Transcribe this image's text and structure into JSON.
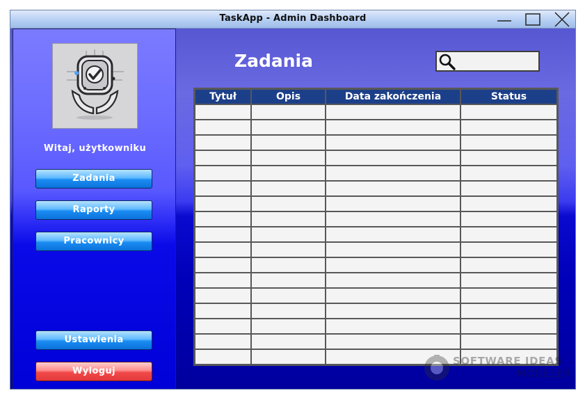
{
  "window": {
    "title": "TaskApp - Admin Dashboard"
  },
  "sidebar": {
    "welcome": "Witaj, użytkowniku",
    "nav": [
      {
        "label": "Zadania"
      },
      {
        "label": "Raporty"
      },
      {
        "label": "Pracownicy"
      }
    ],
    "settings_label": "Ustawienia",
    "logout_label": "Wyloguj"
  },
  "main": {
    "title": "Zadania",
    "search": {
      "value": "",
      "placeholder": ""
    },
    "table": {
      "columns": [
        "Tytuł",
        "Opis",
        "Data zakończenia",
        "Status"
      ],
      "rows": [
        [
          "",
          "",
          "",
          ""
        ],
        [
          "",
          "",
          "",
          ""
        ],
        [
          "",
          "",
          "",
          ""
        ],
        [
          "",
          "",
          "",
          ""
        ],
        [
          "",
          "",
          "",
          ""
        ],
        [
          "",
          "",
          "",
          ""
        ],
        [
          "",
          "",
          "",
          ""
        ],
        [
          "",
          "",
          "",
          ""
        ],
        [
          "",
          "",
          "",
          ""
        ],
        [
          "",
          "",
          "",
          ""
        ],
        [
          "",
          "",
          "",
          ""
        ],
        [
          "",
          "",
          "",
          ""
        ],
        [
          "",
          "",
          "",
          ""
        ],
        [
          "",
          "",
          "",
          ""
        ],
        [
          "",
          "",
          "",
          ""
        ],
        [
          "",
          "",
          "",
          ""
        ],
        [
          "",
          "",
          "",
          ""
        ]
      ]
    }
  },
  "watermark": {
    "line1": "SOFTWARE IDEAS",
    "line2": "MODELER"
  },
  "colors": {
    "header": "#1c3f89",
    "nav_button": "#1b8cf2",
    "logout_button": "#f24a4a"
  },
  "icons": {
    "logo": "task-check-hands-logo",
    "search": "search-icon",
    "minimize": "minimize-icon",
    "maximize": "maximize-icon",
    "close": "close-icon"
  }
}
